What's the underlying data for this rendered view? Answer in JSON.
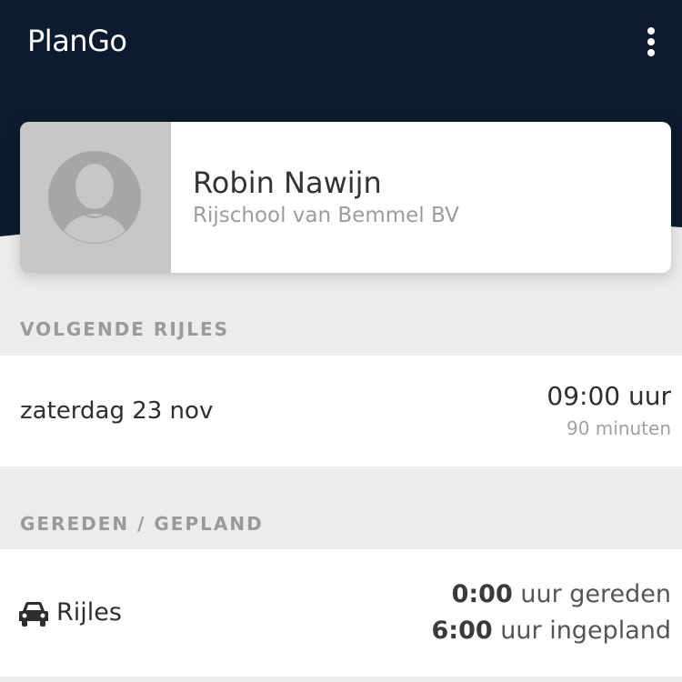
{
  "app": {
    "title": "PlanGo",
    "menu_icon": "more-vertical-icon"
  },
  "colors": {
    "header_bg": "#0c1c2e",
    "page_bg": "#ececec",
    "card_bg": "#ffffff",
    "avatar_bg": "#c7c7c7"
  },
  "profile": {
    "name": "Robin Nawijn",
    "school": "Rijschool van Bemmel BV",
    "avatar_icon": "user-silhouette-icon"
  },
  "next_lesson": {
    "section_label": "VOLGENDE RIJLES",
    "date": "zaterdag 23 nov",
    "time": "09:00 uur",
    "duration": "90 minuten"
  },
  "driven_planned": {
    "section_label": "GEREDEN / GEPLAND",
    "type_icon": "car-icon",
    "type_label": "Rijles",
    "driven_value": "0:00",
    "driven_suffix": "uur gereden",
    "planned_value": "6:00",
    "planned_suffix": "uur ingepland"
  }
}
